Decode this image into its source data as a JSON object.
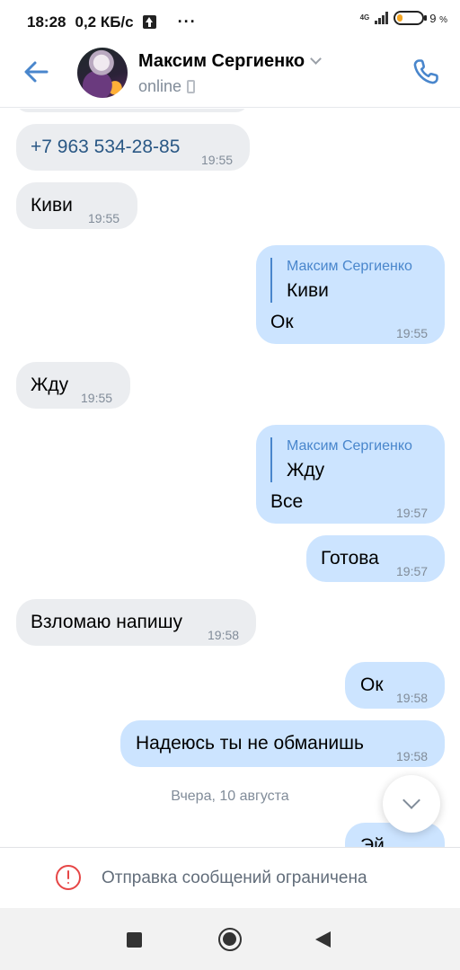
{
  "status_bar": {
    "time": "18:28",
    "speed": "0,2 КБ/с",
    "dots": "···",
    "network": "4G",
    "battery_level": "9",
    "battery_unit": "%"
  },
  "header": {
    "name": "Максим Сергиенко",
    "status": "online"
  },
  "messages": [
    {
      "dir": "in",
      "text": "+7 963 534-28-85",
      "time": "19:55",
      "link": true
    },
    {
      "dir": "in",
      "text": "Киви",
      "time": "19:55"
    },
    {
      "dir": "out",
      "reply_to": {
        "name": "Максим Сергиенко",
        "text": "Киви"
      },
      "text": "Ок",
      "time": "19:55"
    },
    {
      "dir": "in",
      "text": "Жду",
      "time": "19:55"
    },
    {
      "dir": "out",
      "reply_to": {
        "name": "Максим Сергиенко",
        "text": "Жду"
      },
      "text": "Все",
      "time": "19:57"
    },
    {
      "dir": "out",
      "text": "Готова",
      "time": "19:57"
    },
    {
      "dir": "in",
      "text": "Взломаю напишу",
      "time": "19:58"
    },
    {
      "dir": "out",
      "text": "Ок",
      "time": "19:58"
    },
    {
      "dir": "out",
      "text": "Надеюсь ты не обманишь",
      "time": "19:58"
    },
    {
      "dir": "out",
      "text": "Эй",
      "time": ""
    }
  ],
  "date_divider": "Вчера, 10 августа",
  "footer": {
    "restricted_text": "Отправка сообщений ограничена"
  },
  "icons": {
    "back": "arrow-left-icon",
    "call": "phone-icon",
    "scroll": "chevron-down-icon",
    "warning": "exclamation-circle-icon"
  },
  "colors": {
    "accent": "#4986cc",
    "incoming_bubble": "#ebedf0",
    "outgoing_bubble": "#cce4ff",
    "warning": "#e64646"
  }
}
